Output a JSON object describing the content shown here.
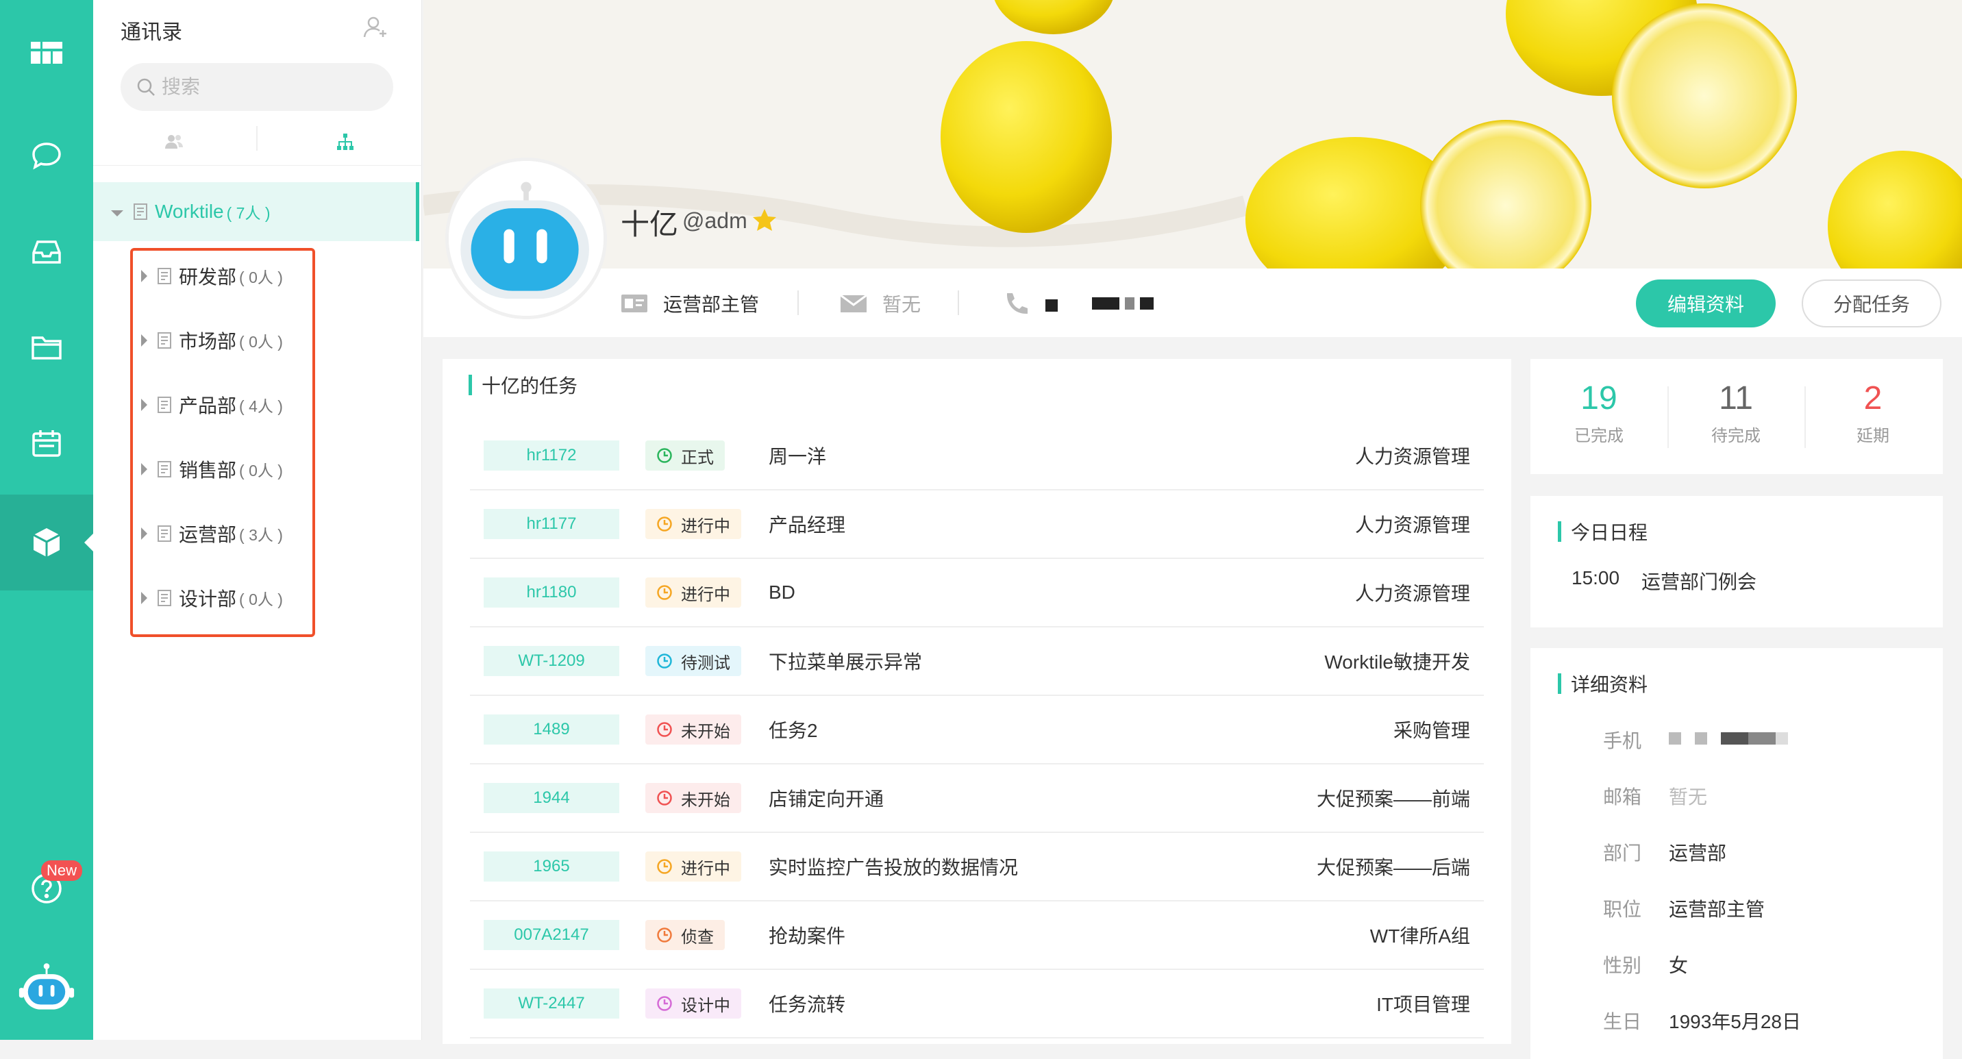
{
  "rail": {
    "new_badge": "New"
  },
  "contacts": {
    "title": "通讯录",
    "search_placeholder": "搜索",
    "root": {
      "label": "Worktile",
      "count": "( 7人 )"
    },
    "departments": [
      {
        "label": "研发部",
        "count": "( 0人 )"
      },
      {
        "label": "市场部",
        "count": "( 0人 )"
      },
      {
        "label": "产品部",
        "count": "( 4人 )"
      },
      {
        "label": "销售部",
        "count": "( 0人 )"
      },
      {
        "label": "运营部",
        "count": "( 3人 )"
      },
      {
        "label": "设计部",
        "count": "( 0人 )"
      }
    ]
  },
  "profile": {
    "name": "十亿",
    "handle": "@adm",
    "title": "运营部主管",
    "email": "暂无",
    "edit_button": "编辑资料",
    "assign_button": "分配任务"
  },
  "tasks": {
    "title": "十亿的任务",
    "rows": [
      {
        "id": "hr1172",
        "status": "正式",
        "status_color": "#2ab55c",
        "status_bg": "#e8f7ed",
        "name": "周一洋",
        "project": "人力资源管理"
      },
      {
        "id": "hr1177",
        "status": "进行中",
        "status_color": "#f5a623",
        "status_bg": "#fef4e4",
        "name": "产品经理",
        "project": "人力资源管理"
      },
      {
        "id": "hr1180",
        "status": "进行中",
        "status_color": "#f5a623",
        "status_bg": "#fef4e4",
        "name": "BD",
        "project": "人力资源管理"
      },
      {
        "id": "WT-1209",
        "status": "待测试",
        "status_color": "#1fb6d8",
        "status_bg": "#e4f6fb",
        "name": "下拉菜单展示异常",
        "project": "Worktile敏捷开发"
      },
      {
        "id": "1489",
        "status": "未开始",
        "status_color": "#f05252",
        "status_bg": "#fdecec",
        "name": "任务2",
        "project": "采购管理"
      },
      {
        "id": "1944",
        "status": "未开始",
        "status_color": "#f05252",
        "status_bg": "#fdecec",
        "name": "店铺定向开通",
        "project": "大促预案——前端"
      },
      {
        "id": "1965",
        "status": "进行中",
        "status_color": "#f5a623",
        "status_bg": "#fef4e4",
        "name": "实时监控广告投放的数据情况",
        "project": "大促预案——后端"
      },
      {
        "id": "007A2147",
        "status": "侦查",
        "status_color": "#f07a3c",
        "status_bg": "#fdeee5",
        "name": "抢劫案件",
        "project": "WT律所A组"
      },
      {
        "id": "WT-2447",
        "status": "设计中",
        "status_color": "#d56ad6",
        "status_bg": "#f9eaf9",
        "name": "任务流转",
        "project": "IT项目管理"
      }
    ]
  },
  "stats": [
    {
      "value": "19",
      "label": "已完成",
      "color": "#2cc7a9"
    },
    {
      "value": "11",
      "label": "待完成",
      "color": "#666666"
    },
    {
      "value": "2",
      "label": "延期",
      "color": "#f05252"
    }
  ],
  "schedule": {
    "title": "今日日程",
    "time": "15:00",
    "text": "运营部门例会"
  },
  "details": {
    "title": "详细资料",
    "phone_label": "手机",
    "email_label": "邮箱",
    "email_value": "暂无",
    "dept_label": "部门",
    "dept_value": "运营部",
    "position_label": "职位",
    "position_value": "运营部主管",
    "gender_label": "性别",
    "gender_value": "女",
    "birthday_label": "生日",
    "birthday_value": "1993年5月28日"
  },
  "icons": [
    "logo-icon",
    "chat-icon",
    "inbox-icon",
    "folder-icon",
    "calendar-icon",
    "cube-icon",
    "help-icon",
    "robot-icon",
    "search-icon",
    "add-user-icon",
    "members-icon",
    "org-tree-icon",
    "id-card-icon",
    "mail-icon",
    "phone-icon",
    "star-icon"
  ],
  "colors": {
    "accent": "#2cc7a9",
    "highlight_box": "#f0502a",
    "star": "#f5c518"
  }
}
